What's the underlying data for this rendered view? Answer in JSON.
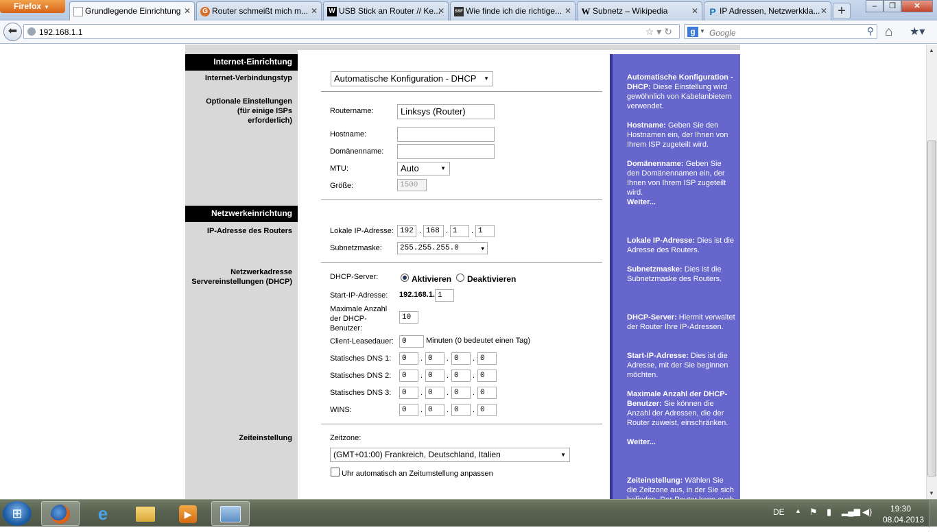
{
  "browser": {
    "menu_label": "Firefox",
    "tabs": [
      {
        "label": "Grundlegende Einrichtung",
        "icon": "page-icon"
      },
      {
        "label": "Router schmeißt mich m...",
        "icon": "forum-icon"
      },
      {
        "label": "USB Stick an Router // Ke...",
        "icon": "w-icon"
      },
      {
        "label": "Wie finde ich die richtige...",
        "icon": "ssf-icon"
      },
      {
        "label": "Subnetz – Wikipedia",
        "icon": "wikipedia-icon"
      },
      {
        "label": "IP Adressen, Netzwerkkla...",
        "icon": "p-icon"
      }
    ],
    "url": "192.168.1.1",
    "search_placeholder": "Google"
  },
  "sections": {
    "internet": "Internet-Einrichtung",
    "network": "Netzwerkeinrichtung"
  },
  "labels": {
    "conn_type": "Internet-Verbindungstyp",
    "optional": "Optionale Einstellungen (für einige ISPs erforderlich)",
    "router_ip": "IP-Adresse des Routers",
    "dhcp_settings": "Netzwerkadresse Servereinstellungen (DHCP)",
    "time": "Zeiteinstellung"
  },
  "form": {
    "conn_type_value": "Automatische Konfiguration - DHCP",
    "routername_label": "Routername:",
    "routername_value": "Linksys (Router)",
    "hostname_label": "Hostname:",
    "domain_label": "Domänenname:",
    "mtu_label": "MTU:",
    "mtu_value": "Auto",
    "size_label": "Größe:",
    "size_value": "1500",
    "local_ip_label": "Lokale IP-Adresse:",
    "local_ip": [
      "192",
      "168",
      "1",
      "1"
    ],
    "subnet_label": "Subnetzmaske:",
    "subnet_value": "255.255.255.0",
    "dhcp_server_label": "DHCP-Server:",
    "dhcp_on": "Aktivieren",
    "dhcp_off": "Deaktivieren",
    "start_ip_label": "Start-IP-Adresse:",
    "start_ip_prefix": "192.168.1.",
    "start_ip_value": "1",
    "max_users_label": "Maximale Anzahl der DHCP-Benutzer:",
    "max_users_value": "10",
    "lease_label": "Client-Leasedauer:",
    "lease_value": "0",
    "lease_note": "Minuten (0 bedeutet einen Tag)",
    "dns1_label": "Statisches DNS 1:",
    "dns2_label": "Statisches DNS 2:",
    "dns3_label": "Statisches DNS 3:",
    "wins_label": "WINS:",
    "octet_zero": "0",
    "timezone_label": "Zeitzone:",
    "timezone_value": "(GMT+01:00) Frankreich, Deutschland, Italien",
    "auto_dst_label": "Uhr automatisch an Zeitumstellung anpassen"
  },
  "help": {
    "h1_title": "Automatische Konfiguration - DHCP:",
    "h1_text": " Diese Einstellung wird gewöhnlich von Kabelanbietern verwendet.",
    "h2_title": "Hostname:",
    "h2_text": " Geben Sie den Hostnamen ein, der Ihnen von Ihrem ISP zugeteilt wird.",
    "h3_title": "Domänenname:",
    "h3_text": " Geben Sie den Domänennamen ein, der Ihnen von Ihrem ISP zugeteilt wird.",
    "more1": "Weiter...",
    "h4_title": "Lokale IP-Adresse:",
    "h4_text": " Dies ist die Adresse des Routers.",
    "h5_title": "Subnetzmaske:",
    "h5_text": " Dies ist die Subnetzmaske des Routers.",
    "h6_title": "DHCP-Server:",
    "h6_text": " Hiermit verwaltet der Router Ihre IP-Adressen.",
    "h7_title": "Start-IP-Adresse:",
    "h7_text": " Dies ist die Adresse, mit der Sie beginnen möchten.",
    "h8_title": "Maximale Anzahl der DHCP-Benutzer:",
    "h8_text": " Sie können die Anzahl der Adressen, die der Router zuweist, einschränken.",
    "more2": "Weiter...",
    "h9_title": "Zeiteinstellung:",
    "h9_text": " Wählen Sie die Zeitzone aus, in der Sie sich befinden. Der Router kann auch"
  },
  "taskbar": {
    "lang": "DE",
    "time": "19:30",
    "date": "08.04.2013"
  }
}
